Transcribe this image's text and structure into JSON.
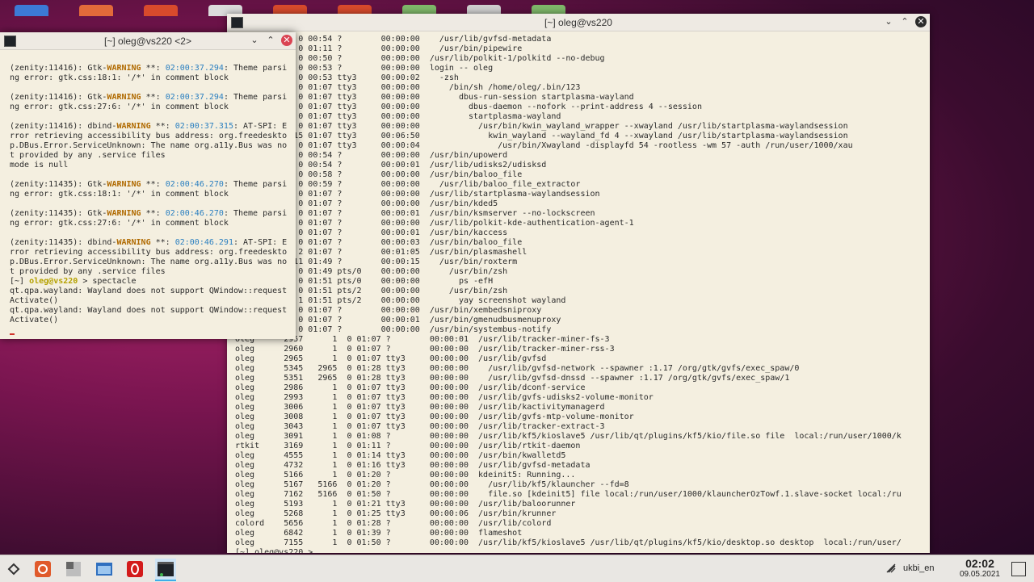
{
  "desktop": {
    "icon_colors": [
      "#3c7ad6",
      "#e26a3a",
      "#d84a2c",
      "#dcdcdc",
      "#d84a2c",
      "#d84a2c",
      "#7fb86a",
      "#cfcfcf",
      "#7fb86a"
    ]
  },
  "big_window": {
    "title": "[~] oleg@vs220",
    "lines": [
      "1361    474  0 00:54 ?        00:00:00    /usr/lib/gvfsd-metadata",
      "3167    474  0 01:11 ?        00:00:00    /usr/bin/pipewire",
      " 520      1  0 00:50 ?        00:00:00  /usr/lib/polkit-1/polkitd --no-debug",
      " 689      1  0 00:53 ?        00:00:00  login -- oleg",
      " 690    689  0 00:53 tty3     00:00:02    -zsh",
      "2855    690  0 01:07 tty3     00:00:00      /bin/sh /home/oleg/.bin/123",
      "2856   2855  0 01:07 tty3     00:00:00        dbus-run-session startplasma-wayland",
      "2857   2856  0 01:07 tty3     00:00:00          dbus-daemon --nofork --print-address 4 --session",
      "2858   2856  0 01:07 tty3     00:00:00          startplasma-wayland",
      "2865   2858  0 01:07 tty3     00:00:00            /usr/bin/kwin_wayland_wrapper --xwayland /usr/lib/startplasma-waylandsession",
      "2866   2865 15 01:07 tty3     00:06:50              kwin_wayland --wayland_fd 4 --xwayland /usr/lib/startplasma-waylandsession",
      "2875   2866  0 01:07 tty3     00:00:04                /usr/bin/Xwayland -displayfd 54 -rootless -wm 57 -auth /run/user/1000/xau",
      "2884      1  0 00:54 ?        00:00:00  /usr/bin/upowerd",
      "1331      1  0 00:54 ?        00:00:01  /usr/lib/udisks2/udisksd",
      "2449      1  0 00:58 ?        00:00:00  /usr/bin/baloo_file",
      "2587   2449  0 00:59 ?        00:00:00    /usr/lib/baloo_file_extractor",
      "2881      1  0 01:07 ?        00:00:00  /usr/lib/startplasma-waylandsession",
      "2911      1  0 01:07 ?        00:00:00  /usr/bin/kded5",
      "2921      1  0 01:07 ?        00:00:01  /usr/bin/ksmserver --no-lockscreen",
      "2933      1  0 01:07 ?        00:00:00  /usr/lib/polkit-kde-authentication-agent-1",
      "2935      1  0 01:07 ?        00:00:01  /usr/bin/kaccess",
      "2937      1  0 01:07 ?        00:00:03  /usr/bin/baloo_file",
      "2939      1  2 01:07 ?        00:01:05  /usr/bin/plasmashell",
      "7091   2939 11 01:49 ?        00:00:15    /usr/bin/roxterm",
      "7100   7091  0 01:49 pts/0    00:00:00      /usr/bin/zsh",
      "7201   7100  0 01:51 pts/0    00:00:00        ps -efH",
      "7171   7091  0 01:51 pts/2    00:00:00      /usr/bin/zsh",
      "7189   7171  1 01:51 pts/2    00:00:00        yay screenshot wayland",
      "2941      1  0 01:07 ?        00:00:00  /usr/bin/xembedsniproxy",
      "2949      1  0 01:07 ?        00:00:01  /usr/bin/gmenudbusmenuproxy",
      "2954      1  0 01:07 ?        00:00:00  /usr/bin/systembus-notify",
      "oleg      2957      1  0 01:07 ?        00:00:01  /usr/lib/tracker-miner-fs-3",
      "oleg      2960      1  0 01:07 ?        00:00:00  /usr/lib/tracker-miner-rss-3",
      "oleg      2965      1  0 01:07 tty3     00:00:00  /usr/lib/gvfsd",
      "oleg      5345   2965  0 01:28 tty3     00:00:00    /usr/lib/gvfsd-network --spawner :1.17 /org/gtk/gvfs/exec_spaw/0",
      "oleg      5351   2965  0 01:28 tty3     00:00:00    /usr/lib/gvfsd-dnssd --spawner :1.17 /org/gtk/gvfs/exec_spaw/1",
      "oleg      2986      1  0 01:07 tty3     00:00:00  /usr/lib/dconf-service",
      "oleg      2993      1  0 01:07 tty3     00:00:00  /usr/lib/gvfs-udisks2-volume-monitor",
      "oleg      3006      1  0 01:07 tty3     00:00:00  /usr/lib/kactivitymanagerd",
      "oleg      3008      1  0 01:07 tty3     00:00:00  /usr/lib/gvfs-mtp-volume-monitor",
      "oleg      3043      1  0 01:07 tty3     00:00:00  /usr/lib/tracker-extract-3",
      "oleg      3091      1  0 01:08 ?        00:00:00  /usr/lib/kf5/kioslave5 /usr/lib/qt/plugins/kf5/kio/file.so file  local:/run/user/1000/k",
      "rtkit     3169      1  0 01:11 ?        00:00:00  /usr/lib/rtkit-daemon",
      "oleg      4555      1  0 01:14 tty3     00:00:00  /usr/bin/kwalletd5",
      "oleg      4732      1  0 01:16 tty3     00:00:00  /usr/lib/gvfsd-metadata",
      "oleg      5166      1  0 01:20 ?        00:00:00  kdeinit5: Running...",
      "oleg      5167   5166  0 01:20 ?        00:00:00    /usr/lib/kf5/klauncher --fd=8",
      "oleg      7162   5166  0 01:50 ?        00:00:00    file.so [kdeinit5] file local:/run/user/1000/klauncherOzTowf.1.slave-socket local:/ru",
      "oleg      5193      1  0 01:21 tty3     00:00:00  /usr/lib/baloorunner",
      "oleg      5268      1  0 01:25 tty3     00:00:06  /usr/bin/krunner",
      "colord    5656      1  0 01:28 ?        00:00:00  /usr/lib/colord",
      "oleg      6842      1  0 01:39 ?        00:00:00  flameshot",
      "oleg      7155      1  0 01:50 ?        00:00:00  /usr/lib/kf5/kioslave5 /usr/lib/qt/plugins/kf5/kio/desktop.so desktop  local:/run/user/",
      "[~] oleg@vs220 >"
    ]
  },
  "small_window": {
    "title": "[~] oleg@vs220 <2>",
    "blocks": [
      {
        "pid": "(zenity:11416): Gtk-",
        "level": "WARNING",
        "mid": " **: ",
        "time": "02:00:37.294",
        "rest": ": Theme parsi",
        "cont": [
          "ng error: gtk.css:18:1: '/*' in comment block"
        ]
      },
      {
        "pid": "(zenity:11416): Gtk-",
        "level": "WARNING",
        "mid": " **: ",
        "time": "02:00:37.294",
        "rest": ": Theme parsi",
        "cont": [
          "ng error: gtk.css:27:6: '/*' in comment block"
        ]
      },
      {
        "pid": "(zenity:11416): dbind-",
        "level": "WARNING",
        "mid": " **: ",
        "time": "02:00:37.315",
        "rest": ": AT-SPI: E",
        "cont": [
          "rror retrieving accessibility bus address: org.freedeskto",
          "p.DBus.Error.ServiceUnknown: The name org.a11y.Bus was no",
          "t provided by any .service files",
          "mode is null"
        ]
      },
      {
        "pid": "(zenity:11435): Gtk-",
        "level": "WARNING",
        "mid": " **: ",
        "time": "02:00:46.270",
        "rest": ": Theme parsi",
        "cont": [
          "ng error: gtk.css:18:1: '/*' in comment block"
        ]
      },
      {
        "pid": "(zenity:11435): Gtk-",
        "level": "WARNING",
        "mid": " **: ",
        "time": "02:00:46.270",
        "rest": ": Theme parsi",
        "cont": [
          "ng error: gtk.css:27:6: '/*' in comment block"
        ]
      },
      {
        "pid": "(zenity:11435): dbind-",
        "level": "WARNING",
        "mid": " **: ",
        "time": "02:00:46.291",
        "rest": ": AT-SPI: E",
        "cont": [
          "rror retrieving accessibility bus address: org.freedeskto",
          "p.DBus.Error.ServiceUnknown: The name org.a11y.Bus was no",
          "t provided by any .service files"
        ]
      }
    ],
    "prompt_pre": "[~] ",
    "prompt_user": "oleg@vs220",
    "prompt_cmd": " > spectacle",
    "tail": [
      "qt.qpa.wayland: Wayland does not support QWindow::request",
      "Activate()",
      "qt.qpa.wayland: Wayland does not support QWindow::request",
      "Activate()"
    ]
  },
  "taskbar": {
    "items": [
      "app-launcher-icon",
      "settings-icon",
      "files-icon",
      "file-manager-icon",
      "opera-icon",
      "terminal-icon"
    ],
    "keyboard_layout": "ukbi_en",
    "time": "02:02",
    "date": "09.05.2021"
  }
}
